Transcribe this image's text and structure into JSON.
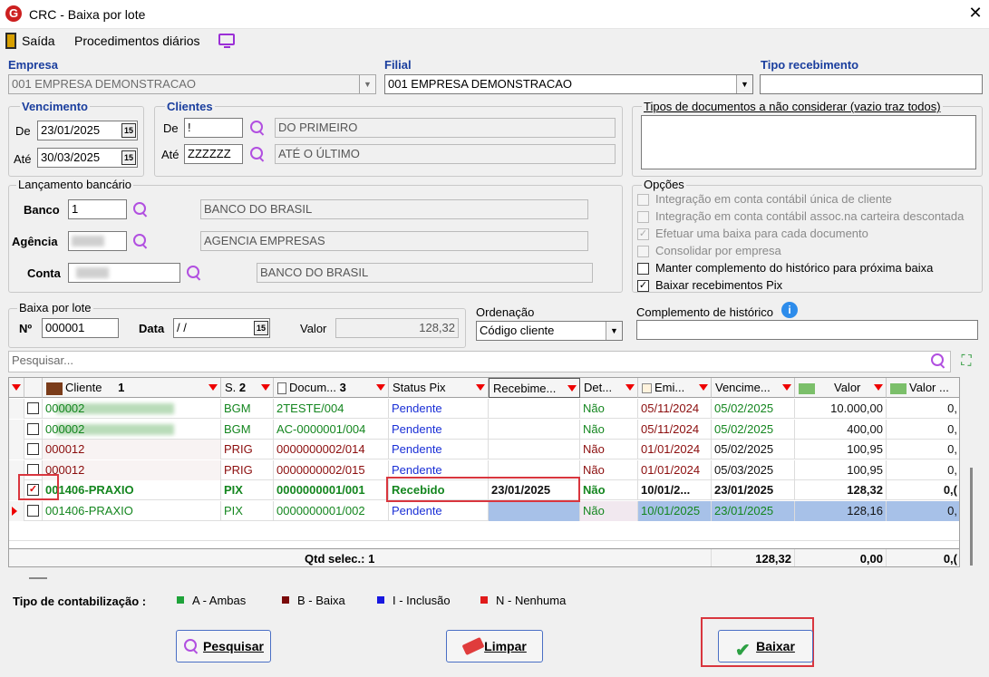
{
  "window": {
    "title": "CRC - Baixa por lote",
    "logo": "G",
    "close": "✕"
  },
  "menu": {
    "exit": "Saída",
    "daily": "Procedimentos diários"
  },
  "empresa": {
    "label": "Empresa",
    "value": "001 EMPRESA DEMONSTRACAO"
  },
  "filial": {
    "label": "Filial",
    "value": "001 EMPRESA DEMONSTRACAO"
  },
  "tipo_recebimento": {
    "label": "Tipo recebimento",
    "value": ""
  },
  "vencimento": {
    "title": "Vencimento",
    "de_label": "De",
    "de": "23/01/2025",
    "ate_label": "Até",
    "ate": "30/03/2025",
    "cal": "15"
  },
  "clientes": {
    "title": "Clientes",
    "de_label": "De",
    "de": "!",
    "de_name": "DO PRIMEIRO",
    "ate_label": "Até",
    "ate": "ZZZZZZ",
    "ate_name": "ATÉ O ÚLTIMO"
  },
  "tipos_docs": {
    "title": "Tipos de documentos a não considerar (vazio traz todos)"
  },
  "lancamento": {
    "title": "Lançamento bancário",
    "banco_label": "Banco",
    "banco": "1",
    "banco_name": "BANCO DO BRASIL",
    "agencia_label": "Agência",
    "agencia_name": "AGENCIA EMPRESAS",
    "conta_label": "Conta",
    "conta_name": "BANCO DO BRASIL"
  },
  "opcoes": {
    "title": "Opções",
    "items": [
      {
        "label": "Integração em conta contábil única de cliente",
        "checked": "",
        "enabled": false
      },
      {
        "label": "Integração em conta contábil assoc.na carteira descontada",
        "checked": "",
        "enabled": false
      },
      {
        "label": "Efetuar uma baixa para cada documento",
        "checked": "✓",
        "enabled": false
      },
      {
        "label": "Consolidar por empresa",
        "checked": "",
        "enabled": false
      },
      {
        "label": "Manter complemento do histórico para próxima baixa",
        "checked": "",
        "enabled": true
      },
      {
        "label": "Baixar recebimentos Pix",
        "checked": "✓",
        "enabled": true
      }
    ]
  },
  "baixa": {
    "title": "Baixa por lote",
    "n_label": "Nº",
    "n": "000001",
    "data_label": "Data",
    "data": " / /",
    "valor_label": "Valor",
    "valor": "128,32"
  },
  "ordenacao": {
    "label": "Ordenação",
    "value": "Código cliente"
  },
  "complemento": {
    "label": "Complemento de histórico",
    "value": ""
  },
  "search": {
    "placeholder": "Pesquisar..."
  },
  "grid": {
    "headers": {
      "cliente": "Cliente",
      "cliente_sort": "1",
      "s": "S.",
      "s_sort": "2",
      "doc": "Docum...",
      "doc_sort": "3",
      "status": "Status Pix",
      "receb": "Recebime...",
      "det": "Det...",
      "emi": "Emi...",
      "venc": "Vencime...",
      "valor": "Valor",
      "valor2": "Valor ..."
    },
    "rows": [
      {
        "check": "",
        "cliente": "000002",
        "s": "BGM",
        "doc": "2TESTE/004",
        "status": "Pendente",
        "receb": "",
        "det": "Não",
        "emi": "05/11/2024",
        "venc": "05/02/2025",
        "valor": "10.000,00",
        "valor2": "0,"
      },
      {
        "check": "",
        "cliente": "000002",
        "s": "BGM",
        "doc": "AC-0000001/004",
        "status": "Pendente",
        "receb": "",
        "det": "Não",
        "emi": "05/11/2024",
        "venc": "05/02/2025",
        "valor": "400,00",
        "valor2": "0,"
      },
      {
        "check": "",
        "cliente": "000012",
        "s": "PRIG",
        "doc": "0000000002/014",
        "status": "Pendente",
        "receb": "",
        "det": "Não",
        "emi": "01/01/2024",
        "venc": "05/02/2025",
        "valor": "100,95",
        "valor2": "0,"
      },
      {
        "check": "",
        "cliente": "000012",
        "s": "PRIG",
        "doc": "0000000002/015",
        "status": "Pendente",
        "receb": "",
        "det": "Não",
        "emi": "01/01/2024",
        "venc": "05/03/2025",
        "valor": "100,95",
        "valor2": "0,"
      },
      {
        "check": "✓",
        "cliente": "001406-PRAXIO",
        "s": "PIX",
        "doc": "0000000001/001",
        "status": "Recebido",
        "receb": "23/01/2025",
        "det": "Não",
        "emi": "10/01/2...",
        "venc": "23/01/2025",
        "valor": "128,32",
        "valor2": "0,("
      },
      {
        "check": "",
        "cliente": "001406-PRAXIO",
        "s": "PIX",
        "doc": "0000000001/002",
        "status": "Pendente",
        "receb": "",
        "det": "Não",
        "emi": "10/01/2025",
        "venc": "23/01/2025",
        "valor": "128,16",
        "valor2": "0,"
      }
    ],
    "footer": {
      "qtd": "Qtd selec.: 1",
      "total": "128,32",
      "total2": "0,00",
      "total3": "0,("
    }
  },
  "legend": {
    "title": "Tipo de contabilização :",
    "items": [
      {
        "color": "#1fa33a",
        "label": "A - Ambas"
      },
      {
        "color": "#7a0a0a",
        "label": "B - Baixa"
      },
      {
        "color": "#1717e0",
        "label": "I - Inclusão"
      },
      {
        "color": "#e01a1a",
        "label": "N - Nenhuma"
      }
    ]
  },
  "buttons": {
    "pesquisar": "Pesquisar",
    "limpar": "Limpar",
    "baixar": "Baixar"
  }
}
